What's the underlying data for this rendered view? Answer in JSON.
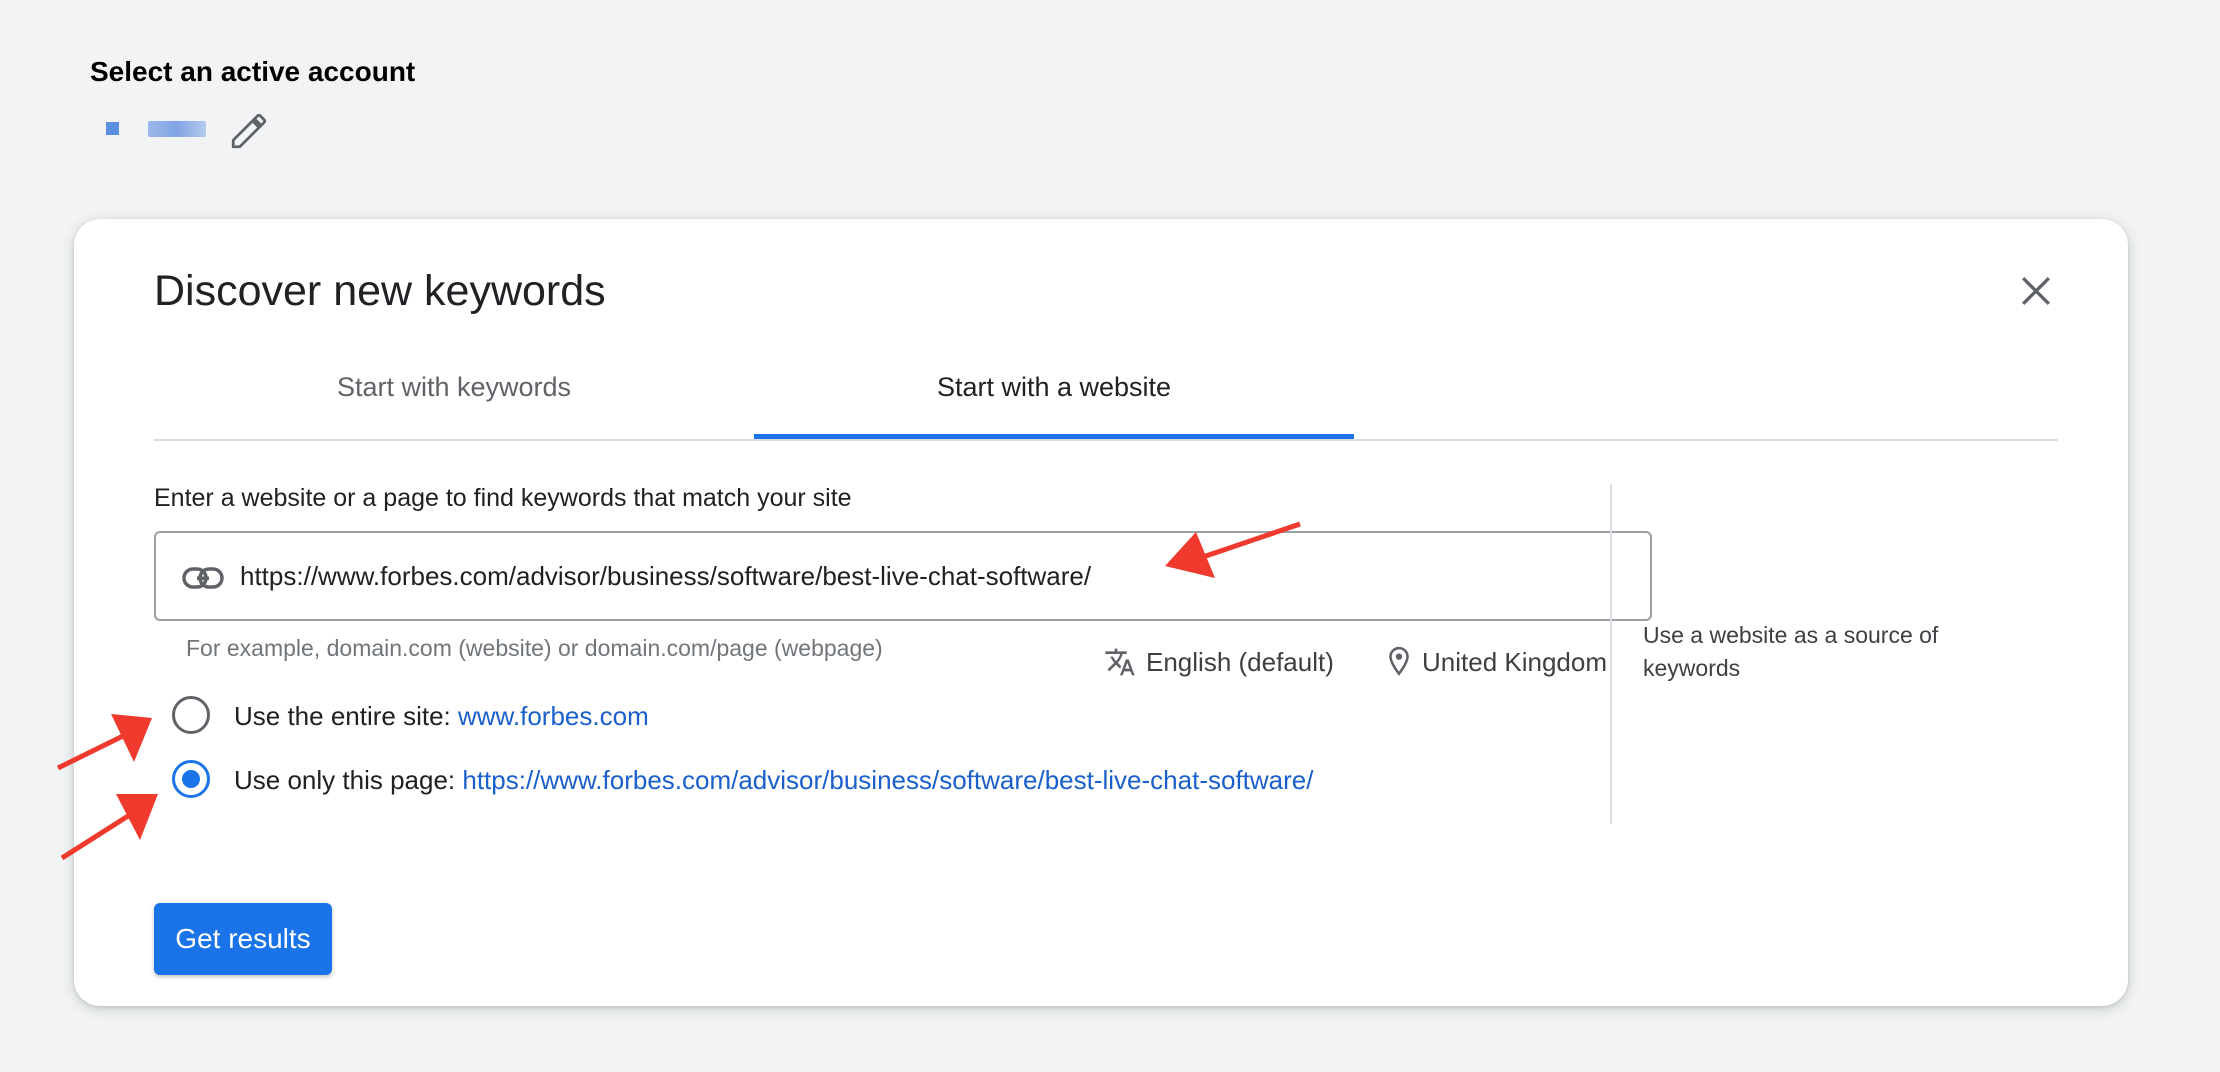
{
  "account": {
    "heading": "Select an active account",
    "edit_icon": "pencil-icon"
  },
  "dialog": {
    "title": "Discover new keywords",
    "close_icon": "close-icon",
    "tabs": [
      {
        "label": "Start with keywords",
        "selected": false
      },
      {
        "label": "Start with a website",
        "selected": true
      }
    ],
    "field_label": "Enter a website or a page to find keywords that match your site",
    "url_value": "https://www.forbes.com/advisor/business/software/best-live-chat-software/",
    "url_icon": "link-icon",
    "hint": "For example, domain.com (website) or domain.com/page (webpage)",
    "language": "English (default)",
    "language_icon": "translate-icon",
    "location": "United Kingdom",
    "location_icon": "location-pin-icon",
    "options": [
      {
        "label": "Use the entire site: ",
        "link": "www.forbes.com",
        "selected": false
      },
      {
        "label": "Use only this page: ",
        "link": "https://www.forbes.com/advisor/business/software/best-live-chat-software/",
        "selected": true
      }
    ],
    "side_text": "Use a website as a source of keywords",
    "submit_label": "Get results"
  },
  "colors": {
    "accent": "#1a73e8",
    "annotation_arrow": "#f03a2e",
    "background": "#f1f3f4"
  }
}
